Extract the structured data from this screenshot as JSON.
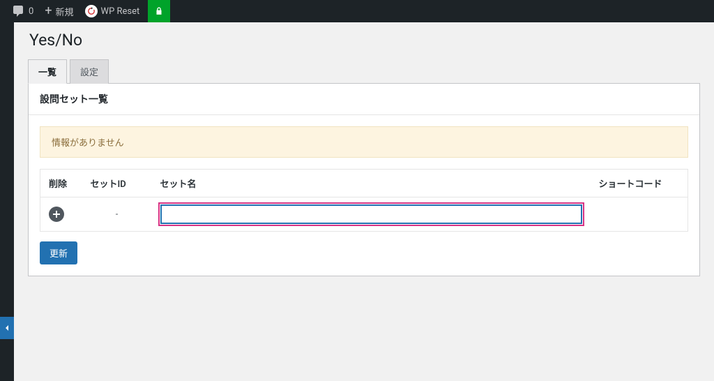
{
  "topbar": {
    "comments_count": "0",
    "new_label": "新規",
    "wp_reset_label": "WP Reset"
  },
  "page_title": "Yes/No",
  "tabs": {
    "list": "一覧",
    "settings": "設定"
  },
  "panel": {
    "heading": "設問セット一覧"
  },
  "notice": {
    "text": "情報がありません"
  },
  "table": {
    "headers": {
      "delete": "削除",
      "set_id": "セットID",
      "set_name": "セット名",
      "shortcode": "ショートコード"
    },
    "row": {
      "set_id": "-",
      "set_name_value": ""
    }
  },
  "buttons": {
    "update": "更新"
  }
}
